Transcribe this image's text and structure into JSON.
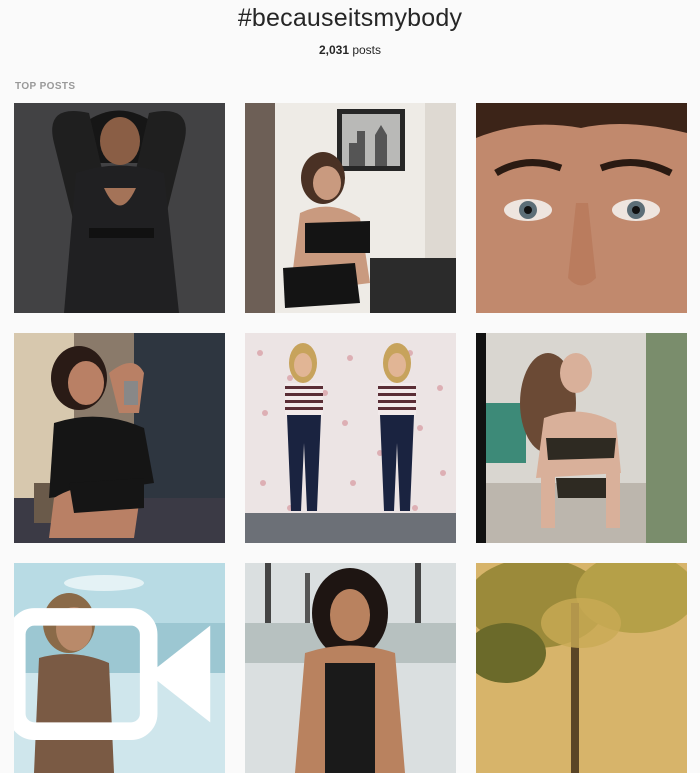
{
  "header": {
    "hashtag": "#becauseitsmybody",
    "post_count": "2,031",
    "post_count_suffix": " posts"
  },
  "section": {
    "label": "TOP POSTS"
  },
  "posts": [
    {
      "icon": "photo-tile"
    },
    {
      "icon": "photo-tile"
    },
    {
      "icon": "photo-tile"
    },
    {
      "icon": "photo-tile"
    },
    {
      "icon": "photo-tile"
    },
    {
      "icon": "photo-tile"
    },
    {
      "icon": "video-tile",
      "badge": "video-camera-icon"
    },
    {
      "icon": "photo-tile"
    },
    {
      "icon": "photo-tile"
    }
  ],
  "colors": {
    "background": "#fafafa",
    "text": "#262626",
    "muted": "#999999"
  }
}
